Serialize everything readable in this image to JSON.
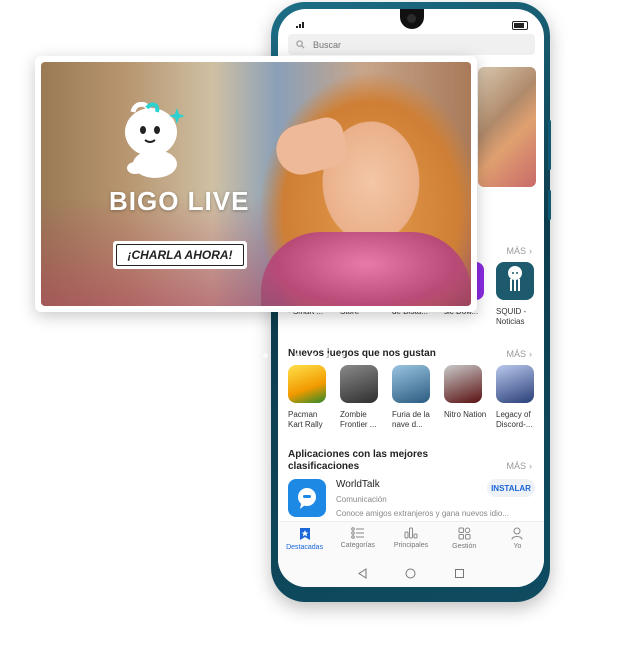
{
  "search": {
    "placeholder": "Buscar"
  },
  "section1": {
    "more_label": "MÁS",
    "apps": [
      {
        "name": "- Smart ...",
        "icon": "app-icon"
      },
      {
        "name": "Store",
        "icon": "store-icon"
      },
      {
        "name": "de Dista...",
        "icon": "app-icon"
      },
      {
        "name": "sic Dow...",
        "icon": "music-icon",
        "color": "#8a2be2"
      },
      {
        "name": "SQUID - Noticias",
        "icon": "squid-icon",
        "color": "#1e5a6e"
      }
    ]
  },
  "section2": {
    "title": "Nuevos juegos que nos gustan",
    "more_label": "MÁS",
    "games": [
      {
        "name": "Pacman Kart Rally",
        "icon": "pacman-icon",
        "color": "#f2c200"
      },
      {
        "name": "Zombie Frontier ...",
        "icon": "zombie-icon",
        "color": "#4a4a4a"
      },
      {
        "name": "Furia de la nave d...",
        "icon": "ship-icon",
        "color": "#3a6a8e"
      },
      {
        "name": "Nitro Nation",
        "icon": "car-icon",
        "color": "#6b1a1a"
      },
      {
        "name": "Legacy of Discord-...",
        "icon": "warrior-icon",
        "color": "#3a5a9a"
      }
    ]
  },
  "section3": {
    "title": "Aplicaciones con las mejores clasificaciones",
    "more_label": "MÁS",
    "app": {
      "name": "WorldTalk",
      "category": "Comunicación",
      "description": "Conoce amigos extranjeros y gana nuevos idio...",
      "install_label": "INSTALAR",
      "color": "#1e88e5"
    }
  },
  "tabs": [
    {
      "label": "Destacadas",
      "icon": "featured-icon",
      "active": true
    },
    {
      "label": "Categorías",
      "icon": "categories-icon",
      "active": false
    },
    {
      "label": "Principales",
      "icon": "top-charts-icon",
      "active": false
    },
    {
      "label": "Gestión",
      "icon": "manage-icon",
      "active": false
    },
    {
      "label": "Yo",
      "icon": "profile-icon",
      "active": false
    }
  ],
  "banner": {
    "brand": "BIGO LIVE",
    "cta": "¡CHARLA AHORA!",
    "dots_total": 8,
    "dots_active": 3
  },
  "colors": {
    "accent": "#1a66d8",
    "phone_frame": "#0f4c61"
  }
}
